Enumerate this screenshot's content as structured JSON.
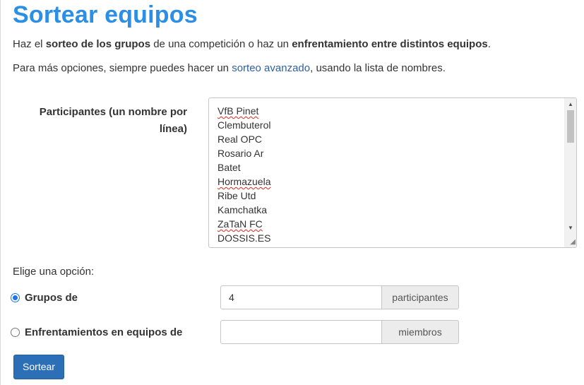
{
  "page": {
    "title": "Sortear equipos",
    "intro": {
      "part1": "Haz el ",
      "bold1": "sorteo de los grupos",
      "part2": " de una competición o haz un ",
      "bold2": "enfrentamiento entre distintos equipos",
      "part3": "."
    },
    "more": {
      "before": "Para más opciones, siempre puedes hacer un ",
      "link": "sorteo avanzado",
      "after": ", usando la lista de nombres."
    }
  },
  "participants": {
    "label_line1": "Participantes (un nombre por",
    "label_line2": "línea)",
    "items": [
      "VfB Pinet",
      "Clembuterol",
      "Real OPC",
      "Rosario Ar",
      "Batet",
      "Hormazuela",
      "Ribe Utd",
      "Kamchatka",
      "ZaTaN FC",
      "DOSSIS.ES"
    ],
    "scroll_up_icon": "▲",
    "scroll_down_icon": "▼",
    "resize_icon": "◢"
  },
  "options": {
    "heading": "Elige una opción:",
    "groups": {
      "label": "Grupos de",
      "value": "4",
      "addon": "participantes",
      "selected": true
    },
    "matchups": {
      "label": "Enfrentamientos en equipos de",
      "value": "",
      "addon": "miembros",
      "selected": false
    }
  },
  "submit": {
    "label": "Sortear"
  },
  "colors": {
    "title": "#2b8fe6",
    "link": "#2e5fa3",
    "button": "#2c6fb7",
    "radio_checked": "#1a73e8"
  }
}
